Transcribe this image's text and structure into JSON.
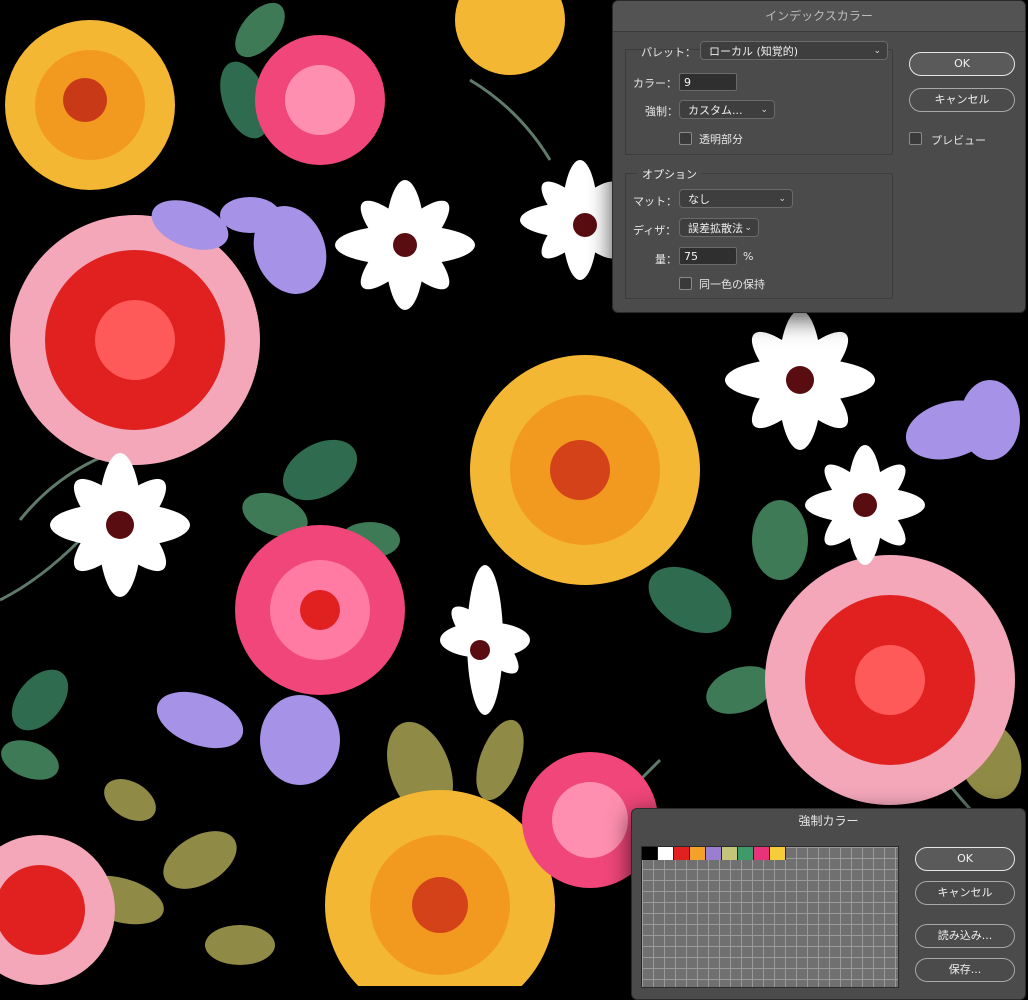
{
  "index_color_dialog": {
    "title": "インデックスカラー",
    "palette_label": "パレット：",
    "palette_value": "ローカル (知覚的)",
    "colors_label": "カラー：",
    "colors_value": "9",
    "forced_label": "強制：",
    "forced_value": "カスタム...",
    "transparency_label": "透明部分",
    "options_legend": "オプション",
    "matte_label": "マット：",
    "matte_value": "なし",
    "dither_label": "ディザ：",
    "dither_value": "誤差拡散法",
    "amount_label": "量：",
    "amount_value": "75",
    "amount_unit": "%",
    "preserve_label": "同一色の保持",
    "ok_label": "OK",
    "cancel_label": "キャンセル",
    "preview_label": "プレビュー"
  },
  "forced_colors_dialog": {
    "title": "強制カラー",
    "ok_label": "OK",
    "cancel_label": "キャンセル",
    "load_label": "読み込み...",
    "save_label": "保存...",
    "swatches": [
      "#000000",
      "#ffffff",
      "#e0211f",
      "#f2a12b",
      "#9a7fd0",
      "#c4c47a",
      "#3f9a6a",
      "#e8327a",
      "#f5cd3a"
    ]
  },
  "icons": {
    "dropdown": "chevron-down-icon"
  }
}
